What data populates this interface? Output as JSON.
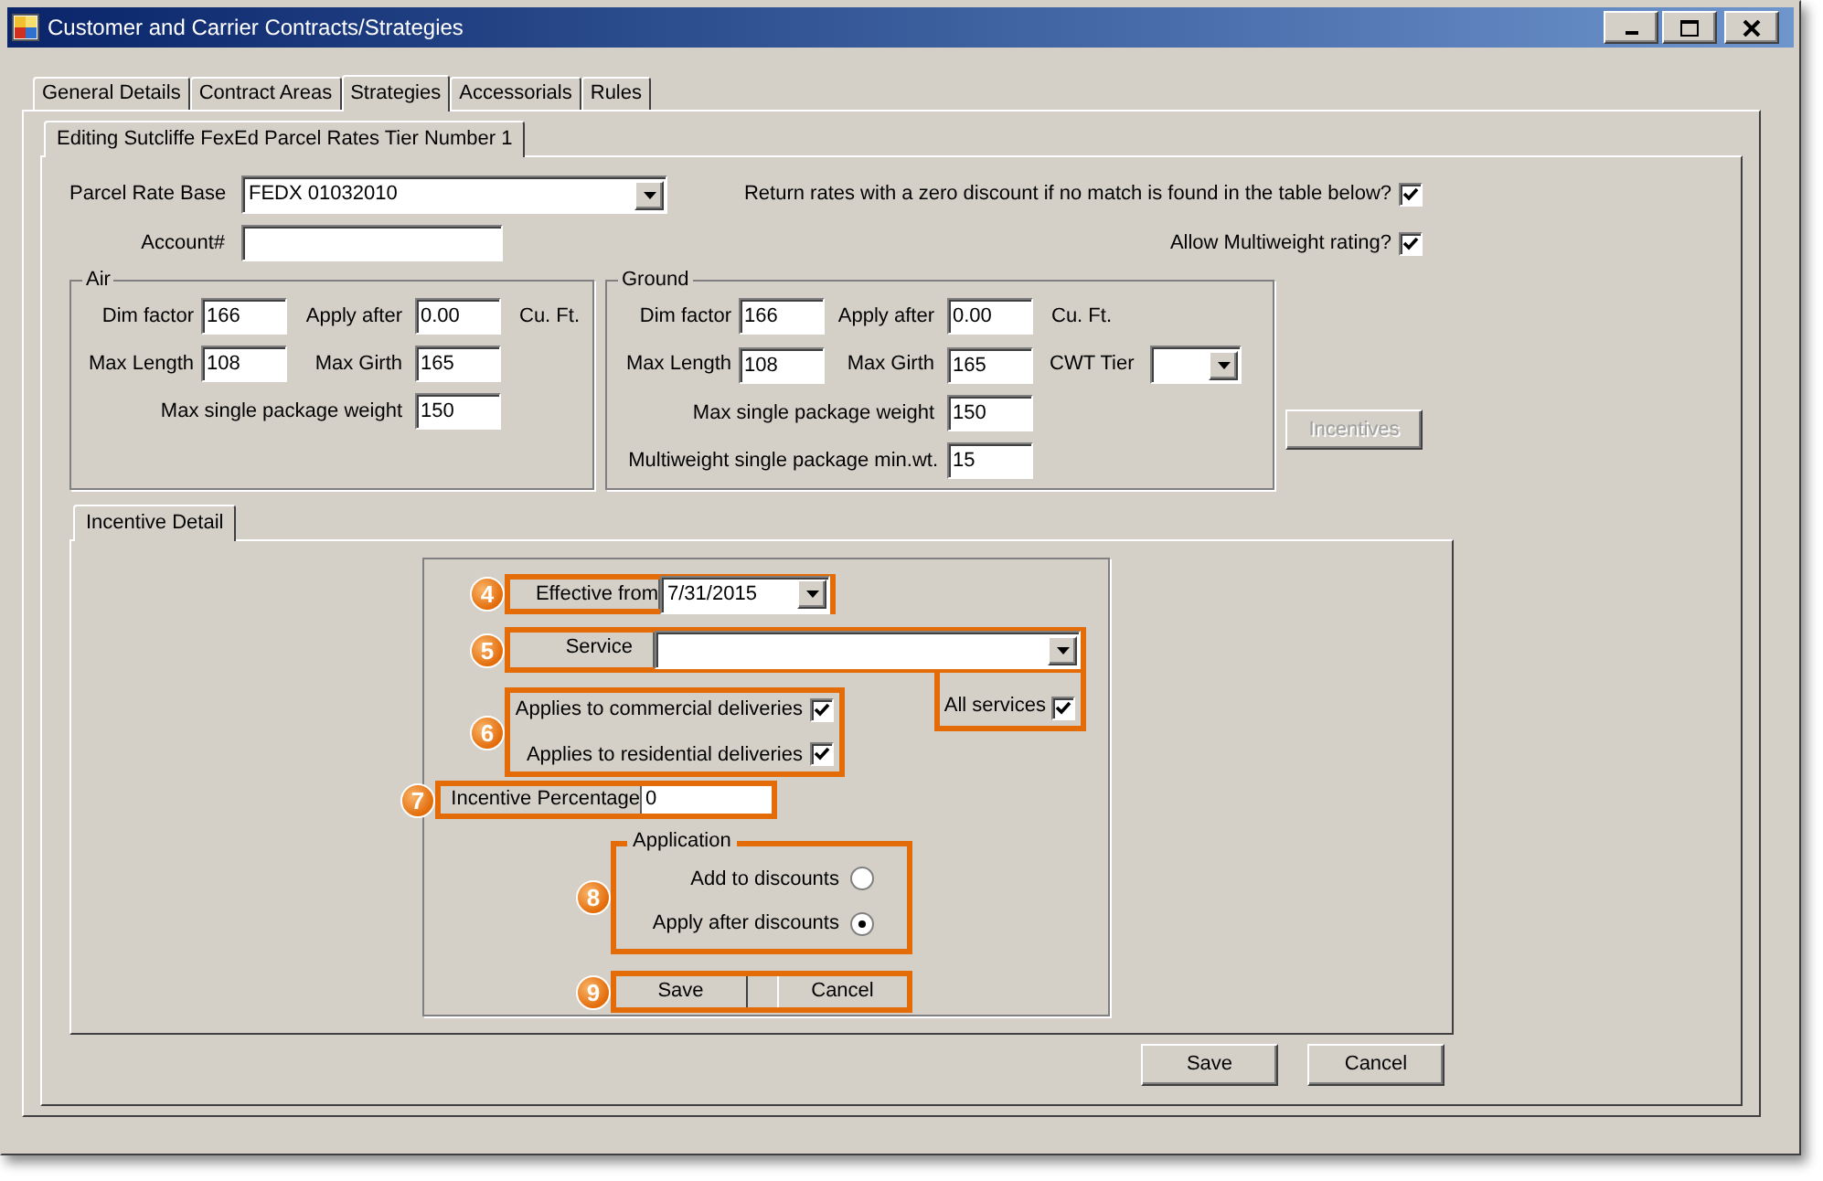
{
  "window": {
    "title": "Customer and Carrier Contracts/Strategies"
  },
  "tabs": [
    {
      "label": "General Details",
      "selected": false
    },
    {
      "label": "Contract Areas",
      "selected": false
    },
    {
      "label": "Strategies",
      "selected": true
    },
    {
      "label": "Accessorials",
      "selected": false
    },
    {
      "label": "Rules",
      "selected": false
    }
  ],
  "subtab": {
    "label": "Editing Sutcliffe FexEd Parcel Rates Tier Number 1"
  },
  "parcel_rate_base": {
    "label": "Parcel Rate Base",
    "value": "FEDX 01032010"
  },
  "account": {
    "label": "Account#"
  },
  "options": [
    {
      "label": "Return rates with a zero discount if no match is found in the table below?",
      "checked": true
    },
    {
      "label": "Allow Multiweight rating?",
      "checked": true
    }
  ],
  "air": {
    "title": "Air",
    "dim_factor": {
      "label": "Dim factor",
      "value": "166"
    },
    "apply_after": {
      "label": "Apply after",
      "value": "0.00",
      "unit": "Cu. Ft."
    },
    "max_length": {
      "label": "Max Length",
      "value": "108"
    },
    "max_girth": {
      "label": "Max Girth",
      "value": "165"
    },
    "max_weight": {
      "label": "Max single package weight",
      "value": "150"
    }
  },
  "ground": {
    "title": "Ground",
    "dim_factor": {
      "label": "Dim factor",
      "value": "166"
    },
    "apply_after": {
      "label": "Apply after",
      "value": "0.00",
      "unit": "Cu. Ft."
    },
    "max_length": {
      "label": "Max Length",
      "value": "108"
    },
    "max_girth": {
      "label": "Max Girth",
      "value": "165"
    },
    "cwt_tier": {
      "label": "CWT Tier"
    },
    "max_weight": {
      "label": "Max single package weight",
      "value": "150"
    },
    "multiweight_min": {
      "label": "Multiweight single package min.wt.",
      "value": "15"
    }
  },
  "incentives_button": {
    "label": "Incentives",
    "disabled": true
  },
  "incentive_detail": {
    "tab": "Incentive Detail",
    "effective_from": {
      "callout": "4",
      "label": "Effective from",
      "value": "7/31/2015"
    },
    "service": {
      "callout": "5",
      "label": "Service"
    },
    "all_services": {
      "label": "All services",
      "checked": true
    },
    "deliveries": {
      "callout": "6",
      "items": [
        {
          "label": "Applies to commercial deliveries",
          "checked": true
        },
        {
          "label": "Applies to residential deliveries",
          "checked": true
        }
      ]
    },
    "incentive_percentage": {
      "callout": "7",
      "label": "Incentive Percentage",
      "value": "0"
    },
    "application": {
      "callout": "8",
      "title": "Application",
      "options": [
        {
          "label": "Add to discounts",
          "selected": false
        },
        {
          "label": "Apply after discounts",
          "selected": true
        }
      ]
    },
    "actions": {
      "callout": "9",
      "buttons": [
        "Save",
        "Cancel"
      ]
    }
  },
  "buttons": [
    "Save",
    "Cancel"
  ]
}
